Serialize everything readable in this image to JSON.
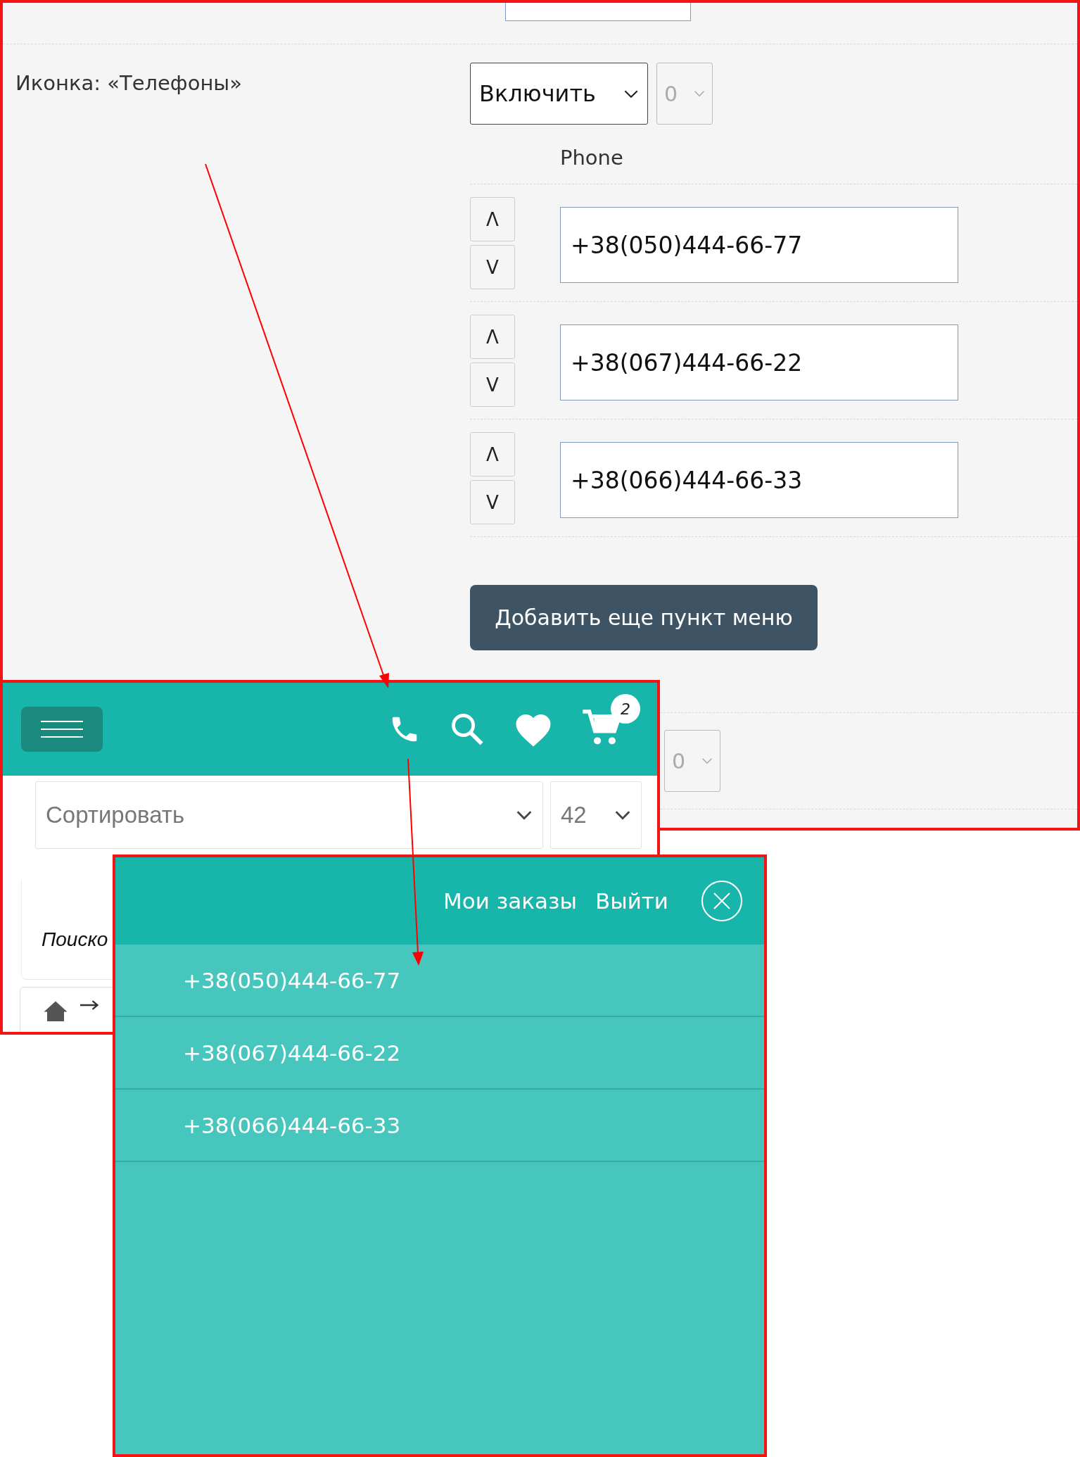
{
  "settings_panel": {
    "icon_setting": {
      "label": "Иконка: «Телефоны»",
      "mode": "Включить",
      "order": "0",
      "order_disabled": true,
      "column_heading": "Phone",
      "items": [
        {
          "up": "Λ",
          "down": "V",
          "value": "+38(050)444-66-77"
        },
        {
          "up": "Λ",
          "down": "V",
          "value": "+38(067)444-66-22"
        },
        {
          "up": "Λ",
          "down": "V",
          "value": "+38(066)444-66-33"
        }
      ],
      "add_button": "Добавить еще пункт меню"
    },
    "next_setting": {
      "order": "0",
      "order_disabled": true
    }
  },
  "mobile_header": {
    "cart_count": "2",
    "sort": {
      "placeholder": "Сортировать"
    },
    "per_page": "42",
    "filter_title": "Поиско"
  },
  "menu_panel": {
    "links": [
      "Мои заказы",
      "Выйти"
    ],
    "phones": [
      "+38(050)444-66-77",
      "+38(067)444-66-22",
      "+38(066)444-66-33"
    ]
  }
}
